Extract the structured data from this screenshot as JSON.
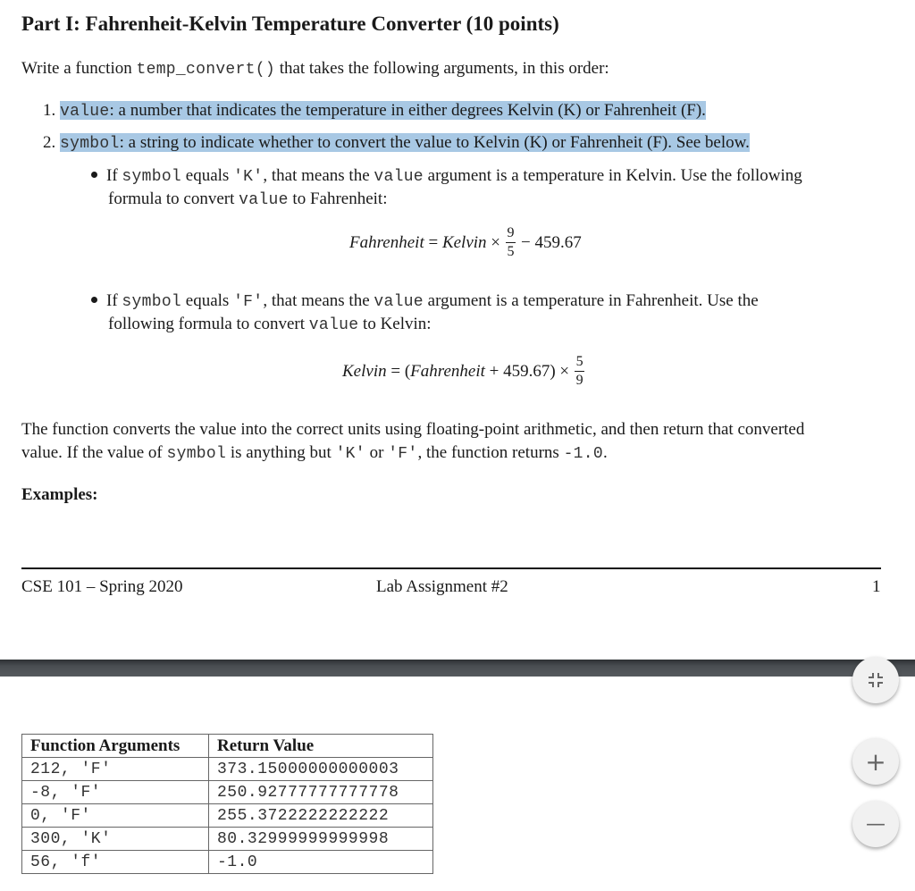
{
  "document": {
    "title": "Part I: Fahrenheit-Kelvin Temperature Converter (10 points)",
    "intro": {
      "pre": "Write a function ",
      "code": "temp_convert()",
      "post": " that takes the following arguments, in this order:"
    },
    "args": [
      {
        "num": "1.",
        "code": "value",
        "text": ": a number that indicates the temperature in either degrees Kelvin (K) or Fahrenheit (F)."
      },
      {
        "num": "2.",
        "code": "symbol",
        "text": ": a string to indicate whether to convert the value to Kelvin (K) or Fahrenheit (F). See below."
      }
    ],
    "bullet_k": {
      "t1": "If ",
      "c1": "symbol",
      "t2": " equals ",
      "c2": "'K'",
      "t3": ", that means the ",
      "c3": "value",
      "t4": " argument is a temperature in Kelvin. Use the following",
      "line2_pre": "formula to convert ",
      "line2_code": "value",
      "line2_post": " to Fahrenheit:"
    },
    "formula_k": {
      "lhs": "Fahrenheit",
      "eq": "=",
      "var": "Kelvin",
      "times": "×",
      "num": "9",
      "den": "5",
      "rest": "− 459.67"
    },
    "bullet_f": {
      "t1": "If ",
      "c1": "symbol",
      "t2": " equals ",
      "c2": "'F'",
      "t3": ", that means the ",
      "c3": "value",
      "t4": " argument is a temperature in Fahrenheit.  Use the",
      "line2_pre": "following formula to convert ",
      "line2_code": "value",
      "line2_post": " to Kelvin:"
    },
    "formula_f": {
      "lhs": "Kelvin",
      "eq": "=",
      "open": "(",
      "var": "Fahrenheit",
      "plus": "+ 459.67)",
      "times": "×",
      "num": "5",
      "den": "9"
    },
    "para": {
      "line1": "The function converts the value into the correct units using floating-point arithmetic, and then return that converted",
      "l2_pre": "value. If the value of ",
      "l2_code1": "symbol",
      "l2_mid": " is anything but ",
      "l2_code2": "'K'",
      "l2_or": " or ",
      "l2_code3": "'F'",
      "l2_post": ", the function returns ",
      "l2_code4": "-1.0",
      "l2_end": "."
    },
    "examples_heading": "Examples:",
    "footer": {
      "left": "CSE 101 – Spring 2020",
      "center": "Lab Assignment #2",
      "page": "1"
    },
    "table": {
      "headers": [
        "Function Arguments",
        "Return Value"
      ],
      "rows": [
        [
          "212, 'F'",
          "373.15000000000003"
        ],
        [
          "-8, 'F'",
          "250.92777777777778"
        ],
        [
          "0, 'F'",
          "255.3722222222222"
        ],
        [
          "300, 'K'",
          "80.32999999999998"
        ],
        [
          "56, 'f'",
          "-1.0"
        ]
      ]
    }
  },
  "viewer_controls": {
    "fit_icon": "fit-to-page-icon",
    "zoom_in_icon": "plus-icon",
    "zoom_out_icon": "minus-icon",
    "plus_glyph": "+",
    "minus_glyph": "—"
  }
}
